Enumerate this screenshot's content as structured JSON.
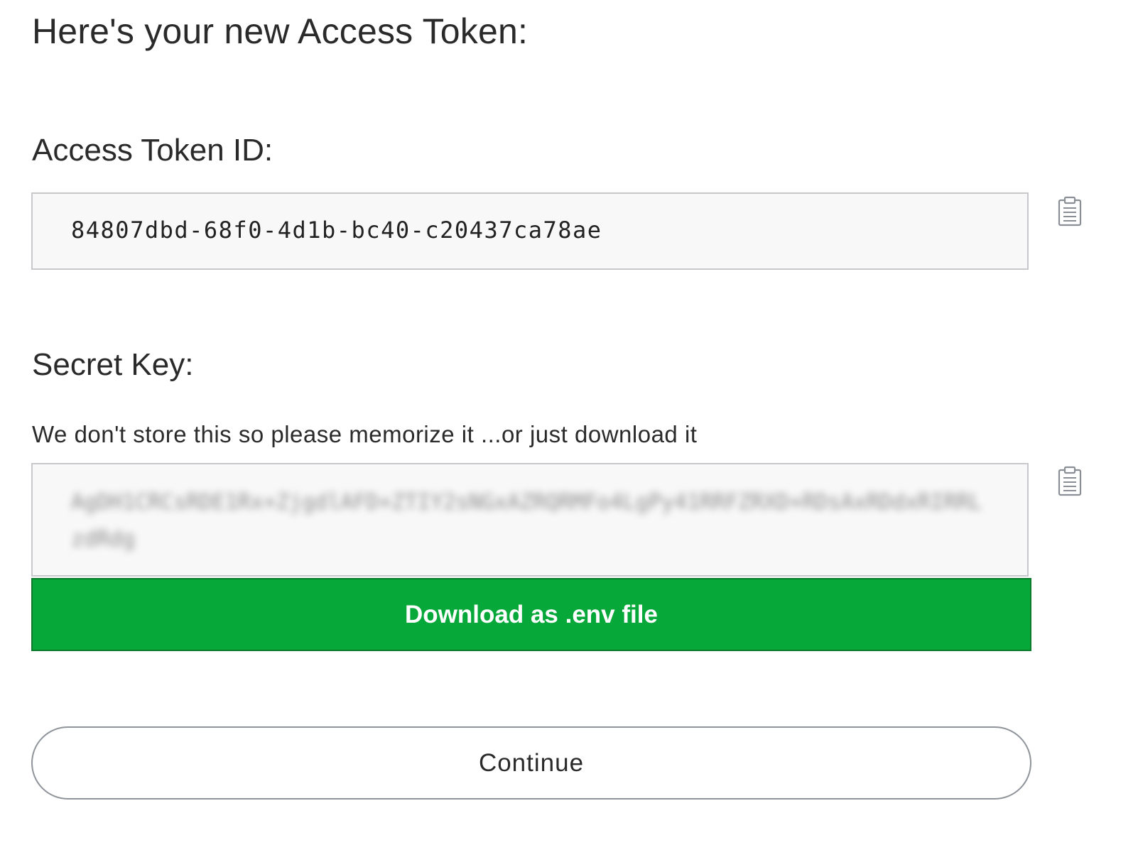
{
  "page": {
    "title": "Here's your new Access Token:"
  },
  "token": {
    "label": "Access Token ID:",
    "value": "84807dbd-68f0-4d1b-bc40-c20437ca78ae",
    "copy_icon": "clipboard-icon"
  },
  "secret": {
    "label": "Secret Key:",
    "help_text": "We don't store this so please memorize it ...or just download it",
    "value_blurred": "AgDH1CRCsRDE1Rx+ZjgdlAFD+ZTIY2sNGxAZRQRMFo4LgPy41RRFZRXD+RDsAxRDdxRIRRLzdRdg",
    "copy_icon": "clipboard-icon"
  },
  "actions": {
    "download_label": "Download as .env file",
    "continue_label": "Continue"
  },
  "colors": {
    "download_bg": "#06a83a",
    "field_bg": "#f8f8f8",
    "border": "#c7c8cb",
    "text": "#2a2a2a"
  }
}
